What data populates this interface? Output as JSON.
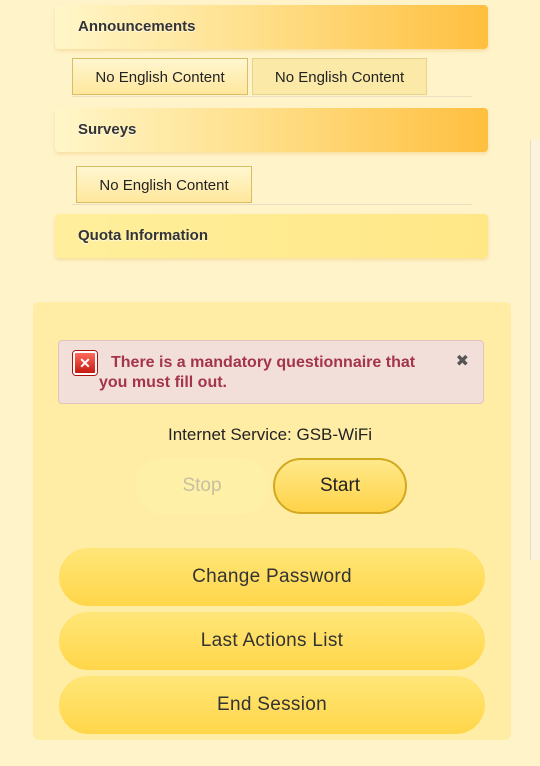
{
  "sections": {
    "announcements": {
      "title": "Announcements",
      "tabs": [
        "No English Content",
        "No English Content"
      ]
    },
    "surveys": {
      "title": "Surveys",
      "tabs": [
        "No English Content"
      ]
    },
    "quota": {
      "title": "Quota Information"
    }
  },
  "alert": {
    "message": "There is a mandatory questionnaire that you must fill out.",
    "close_symbol": "✖",
    "icon": "error-x-icon"
  },
  "service": {
    "label": "Internet Service: GSB-WiFi"
  },
  "controls": {
    "stop_label": "Stop",
    "start_label": "Start"
  },
  "actions": {
    "change_password": "Change Password",
    "last_actions": "Last Actions List",
    "end_session": "End Session"
  },
  "colors": {
    "background": "#fff3c9",
    "header_accent": "#ffbf3f",
    "button": "#ffd64a",
    "alert_text": "#a4344a"
  }
}
